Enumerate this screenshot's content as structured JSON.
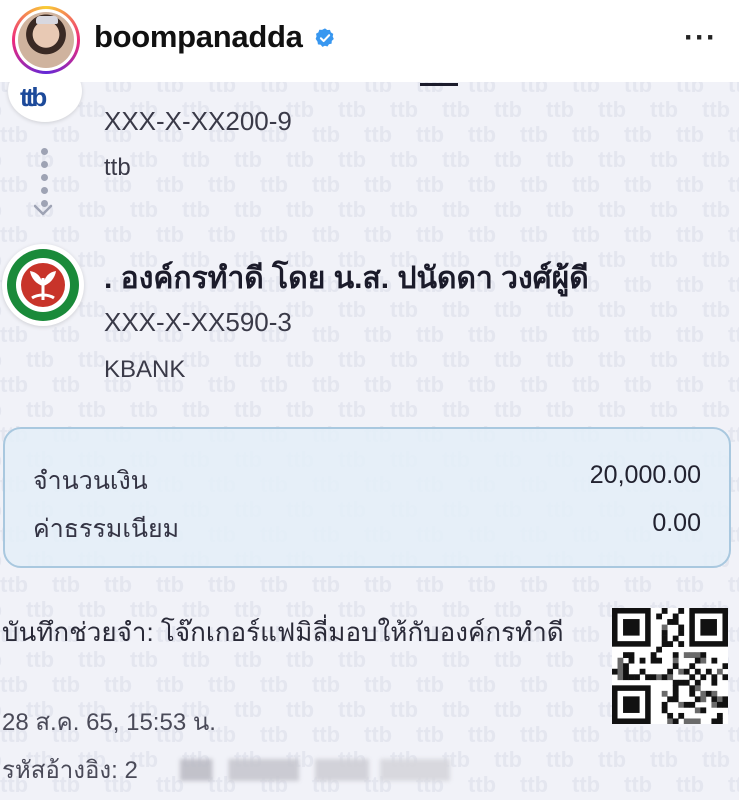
{
  "post": {
    "username": "boompanadda",
    "verified_icon": "verified-badge-icon",
    "more_icon": "more-horizontal-icon",
    "more_label": "···"
  },
  "slip": {
    "sender": {
      "account": "XXX-X-XX200-9",
      "bank": "ttb",
      "logo": "ttb-logo"
    },
    "receiver": {
      "name": ". องค์กรทำดี โดย น.ส. ปนัดดา  วงศ์ผู้ดี",
      "account": "XXX-X-XX590-3",
      "bank": "KBANK",
      "logo": "kbank-logo"
    },
    "amount": {
      "label": "จำนวนเงิน",
      "value": "20,000.00"
    },
    "fee": {
      "label": "ค่าธรรมเนียม",
      "value": "0.00"
    },
    "memo": "บันทึกช่วยจำ: โจ๊กเกอร์แฟมิลี่มอบให้กับองค์กรทำดี",
    "datetime": "28 ส.ค. 65, 15:53 น.",
    "reference_label": "รหัสอ้างอิง: 2",
    "watermark_text": "ttb",
    "colors": {
      "background": "#f1f2f8",
      "box_border": "#a9c8df",
      "kbank_green": "#1a8a3a",
      "ttb_blue": "#1d4a9a",
      "verified_blue": "#3897f0"
    }
  }
}
